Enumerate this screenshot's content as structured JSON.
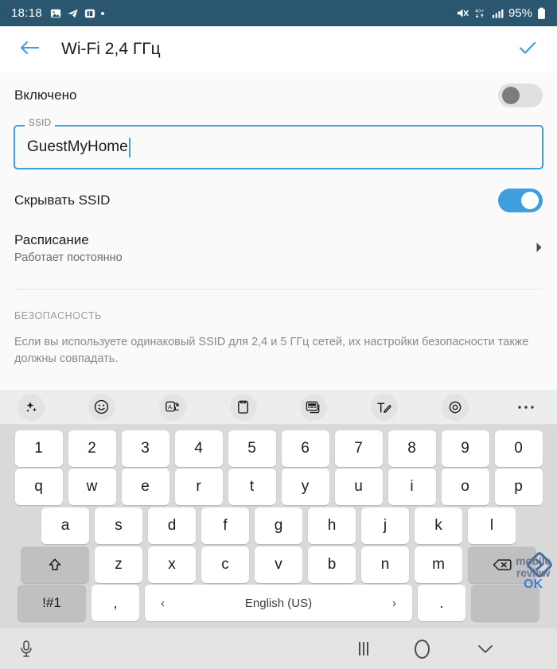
{
  "statusbar": {
    "time": "18:18",
    "left_icons": [
      "photos-icon",
      "telegram-icon",
      "app-icon",
      "dot-indicator"
    ],
    "right_icons": [
      "mute-icon",
      "network-4g-plus-icon",
      "signal-bars-icon"
    ],
    "battery_text": "95%",
    "battery_icon": "battery-icon",
    "bg_color": "#2a5670"
  },
  "appbar": {
    "back_icon": "arrow-left-icon",
    "title": "Wi-Fi 2,4 ГГц",
    "confirm_icon": "check-icon",
    "accent_color": "#3e9fdc"
  },
  "content": {
    "enabled_row": {
      "label": "Включено",
      "toggle_state": "off"
    },
    "ssid_field": {
      "legend": "SSID",
      "value": "GuestMyHome",
      "placeholder": "SSID",
      "focused": true
    },
    "hide_ssid_row": {
      "label": "Скрывать SSID",
      "toggle_state": "on"
    },
    "schedule_row": {
      "title": "Расписание",
      "subtitle": "Работает постоянно",
      "chevron": "chevron-right-icon"
    },
    "security_section": {
      "heading": "БЕЗОПАСНОСТЬ",
      "body": "Если вы используете одинаковый SSID для 2,4 и 5 ГГц сетей, их настройки безопасности также должны совпадать."
    }
  },
  "keyboard": {
    "toolbar_icons": [
      "ai-sparkle-icon",
      "emoji-icon",
      "translate-icon",
      "clipboard-icon",
      "keyboard-mode-icon",
      "handwriting-icon",
      "settings-gear-icon",
      "more-options-icon"
    ],
    "row_numbers": [
      "1",
      "2",
      "3",
      "4",
      "5",
      "6",
      "7",
      "8",
      "9",
      "0"
    ],
    "row_top": [
      "q",
      "w",
      "e",
      "r",
      "t",
      "y",
      "u",
      "i",
      "o",
      "p"
    ],
    "row_home": [
      "a",
      "s",
      "d",
      "f",
      "g",
      "h",
      "j",
      "k",
      "l"
    ],
    "row_bottom": [
      "z",
      "x",
      "c",
      "v",
      "b",
      "n",
      "m"
    ],
    "shift_key": "shift-key",
    "backspace_key": "backspace-key",
    "symbols_key": "!#1",
    "comma_key": ",",
    "period_key": ".",
    "space_key": {
      "label": "English (US)",
      "prev": "‹",
      "next": "›"
    }
  },
  "watermark": {
    "line1": "mobile",
    "line2": "review",
    "line3": "OK",
    "logo": "diamond-logo-icon"
  },
  "navbar": {
    "mic_icon": "microphone-icon",
    "recents_icon": "recents-icon",
    "home_icon": "home-icon",
    "hide_keyboard_icon": "chevron-down-icon"
  }
}
